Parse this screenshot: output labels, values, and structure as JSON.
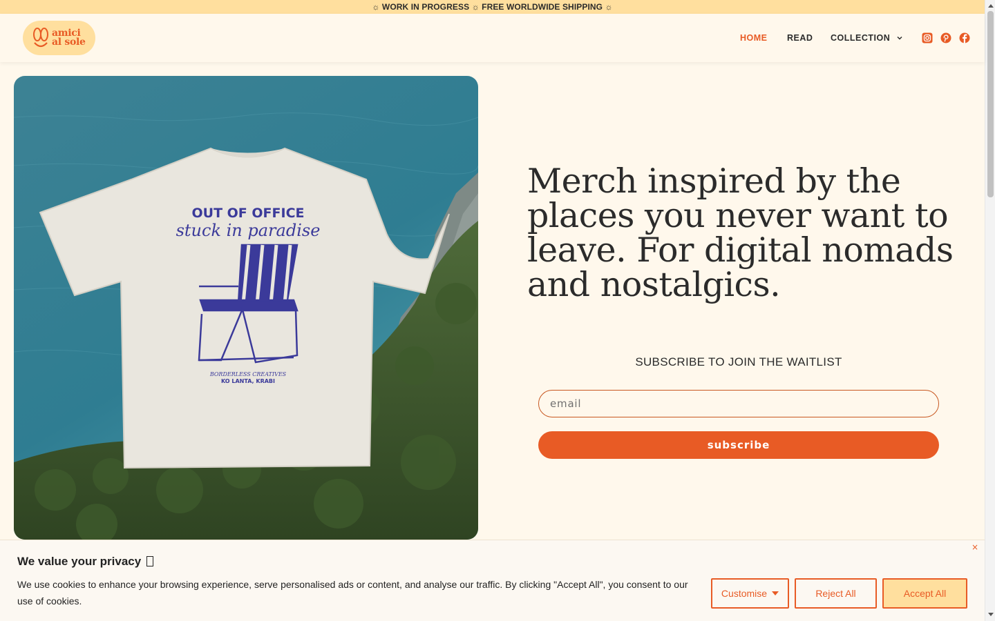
{
  "announcement": "☼ WORK IN PROGRESS ☼ FREE WORLDWIDE SHIPPING ☼",
  "brand": {
    "line1": "amici",
    "line2": "al sole"
  },
  "nav": {
    "home": "HOME",
    "read": "READ",
    "collection": "COLLECTION"
  },
  "social": [
    "instagram-icon",
    "pinterest-icon",
    "facebook-icon"
  ],
  "hero": {
    "headline": "Merch inspired by the places you never want to leave. For digital nomads and nostalgics.",
    "shirt_print": {
      "title": "OUT OF OFFICE",
      "subtitle": "stuck in paradise",
      "credit": "BORDERLESS CREATIVES",
      "location": "KO LANTA, KRABI"
    }
  },
  "waitlist": {
    "title": "SUBSCRIBE TO JOIN THE WAITLIST",
    "email_placeholder": "email",
    "button": "subscribe"
  },
  "cookie": {
    "title": "We value your privacy",
    "text": "We use cookies to enhance your browsing experience, serve personalised ads or content, and analyse our traffic. By clicking \"Accept All\", you consent to our use of cookies.",
    "close": "×",
    "customise": "Customise",
    "reject": "Reject All",
    "accept": "Accept All"
  },
  "colors": {
    "accent": "#e85b25",
    "banner": "#ffdf9e",
    "background": "#fff8ec",
    "print": "#3b3a9a"
  }
}
